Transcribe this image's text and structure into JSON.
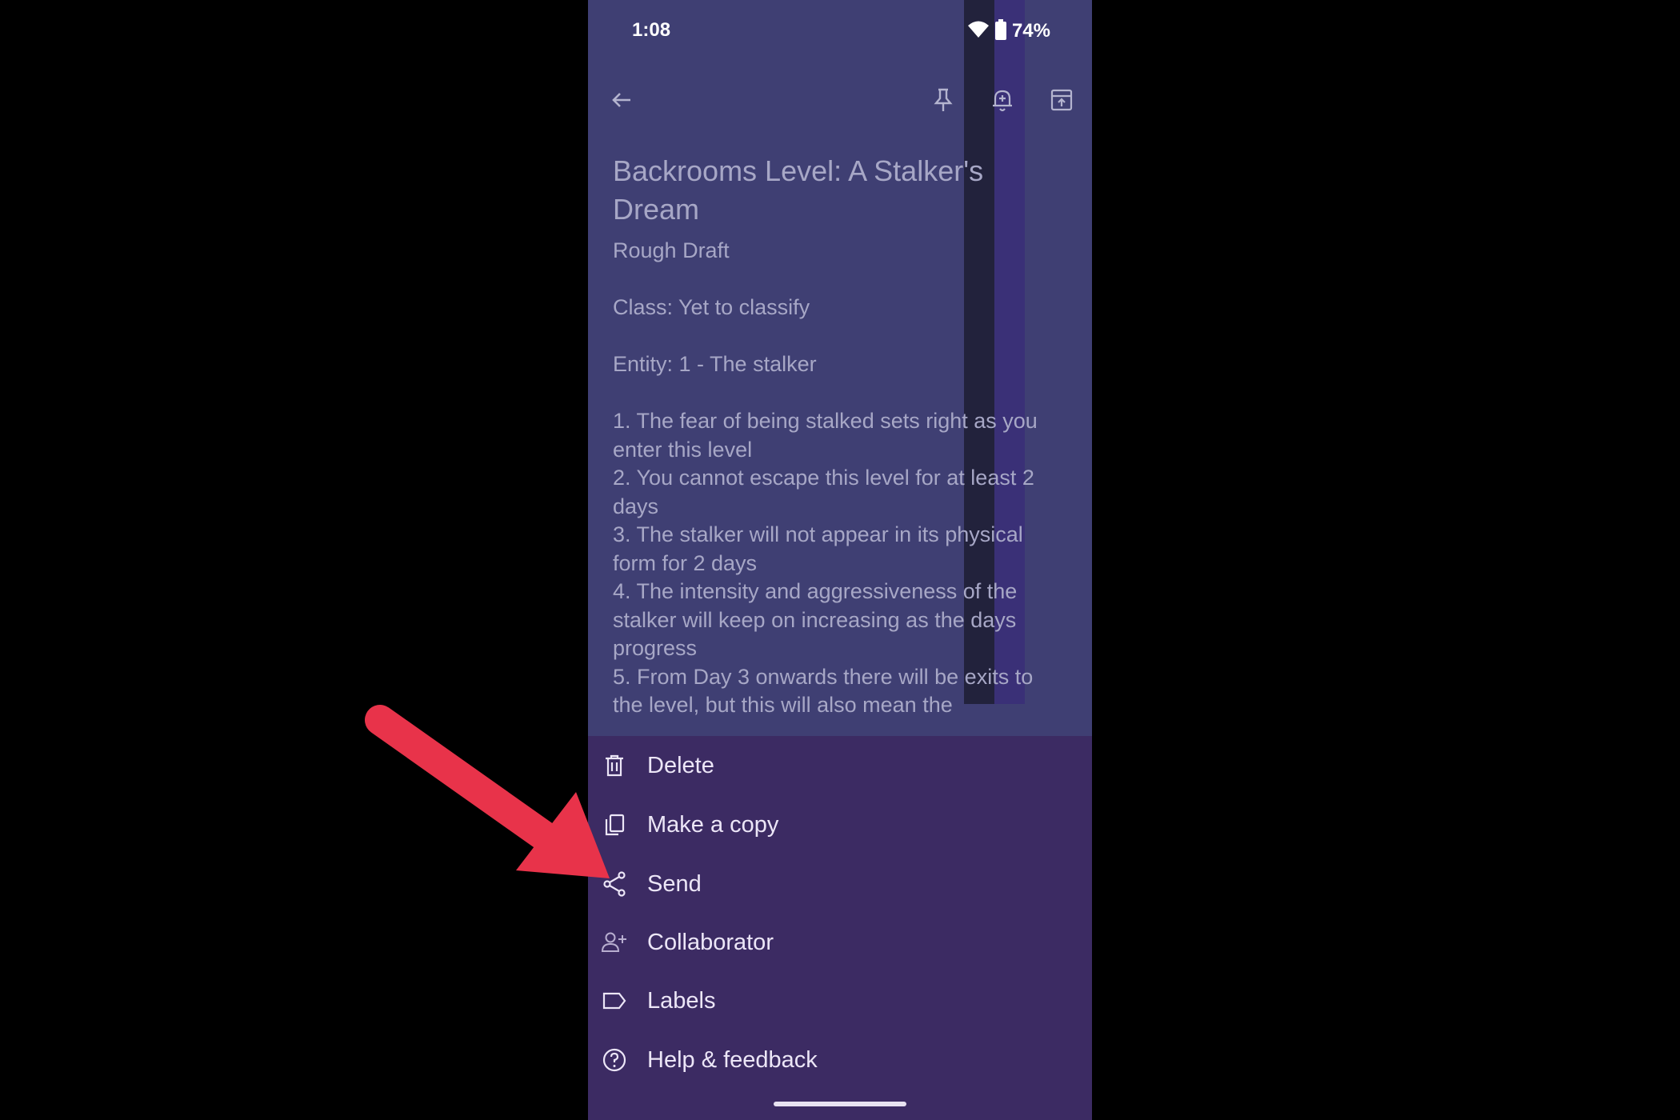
{
  "status_bar": {
    "time": "1:08",
    "battery_percent": "74%",
    "icons": [
      "wifi-icon",
      "battery-icon"
    ]
  },
  "toolbar": {
    "icons": [
      "back-arrow-icon",
      "pin-icon",
      "reminder-bell-icon",
      "archive-icon"
    ]
  },
  "note": {
    "title": "Backrooms Level: A Stalker's Dream",
    "lines": [
      "Rough Draft",
      "",
      "Class: Yet to classify",
      "",
      "Entity: 1 - The stalker",
      "",
      "1. The fear of being stalked sets right as you enter this level",
      "2. You cannot escape this level for at least 2 days",
      "3. The stalker will not appear in its physical form for 2 days",
      "4. The intensity and aggressiveness of the stalker will keep on increasing as the days progress",
      "5. From Day 3 onwards there will be exits to the level, but this will also mean the"
    ]
  },
  "menu": {
    "items": [
      {
        "label": "Delete",
        "icon": "trash-icon"
      },
      {
        "label": "Make a copy",
        "icon": "copy-icon"
      },
      {
        "label": "Send",
        "icon": "share-icon"
      },
      {
        "label": "Collaborator",
        "icon": "add-person-icon"
      },
      {
        "label": "Labels",
        "icon": "label-icon"
      },
      {
        "label": "Help & feedback",
        "icon": "help-icon"
      }
    ]
  },
  "colors": {
    "note_background": "#3f3f73",
    "menu_background": "#3c2b63",
    "annotation_arrow": "#e8334a"
  }
}
